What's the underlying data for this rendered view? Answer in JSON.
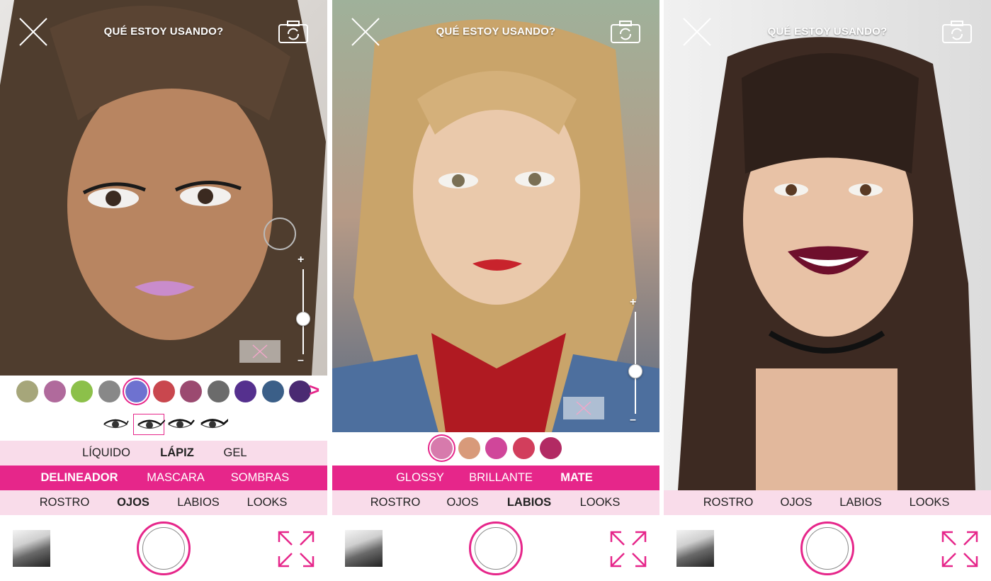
{
  "screens": [
    {
      "title": "QUÉ ESTOY USANDO?",
      "swatches": [
        {
          "color": "#a6a67a",
          "selected": false
        },
        {
          "color": "#b06a9c",
          "selected": false
        },
        {
          "color": "#8cc04a",
          "selected": false
        },
        {
          "color": "#888888",
          "selected": false
        },
        {
          "color": "#6e72d0",
          "selected": true
        },
        {
          "color": "#c9474e",
          "selected": false
        },
        {
          "color": "#9b4a70",
          "selected": false
        },
        {
          "color": "#6b6b6b",
          "selected": false
        },
        {
          "color": "#55308e",
          "selected": false
        },
        {
          "color": "#3b5f88",
          "selected": false
        },
        {
          "color": "#4a2a72",
          "selected": false
        }
      ],
      "next_arrow": ">",
      "eye_styles": [
        {
          "icon": "eyeliner-style-1-icon",
          "selected": false
        },
        {
          "icon": "eyeliner-style-2-icon",
          "selected": true
        },
        {
          "icon": "eyeliner-style-3-icon",
          "selected": false
        },
        {
          "icon": "eyeliner-style-4-icon",
          "selected": false
        }
      ],
      "finish_row": [
        "LÍQUIDO",
        "LÁPIZ",
        "GEL"
      ],
      "finish_selected": "LÁPIZ",
      "product_row": [
        "DELINEADOR",
        "MASCARA",
        "SOMBRAS"
      ],
      "product_selected": "DELINEADOR",
      "category_row": [
        "ROSTRO",
        "OJOS",
        "LABIOS",
        "LOOKS"
      ],
      "category_selected": "OJOS",
      "slider_plus": "+",
      "slider_minus": "–"
    },
    {
      "title": "QUÉ ESTOY USANDO?",
      "swatches": [
        {
          "color": "#d77aac",
          "selected": true
        },
        {
          "color": "#d89a7a",
          "selected": false
        },
        {
          "color": "#d0469a",
          "selected": false
        },
        {
          "color": "#d23e5c",
          "selected": false
        },
        {
          "color": "#b22a63",
          "selected": false
        }
      ],
      "product_row": [
        "GLOSSY",
        "BRILLANTE",
        "MATE"
      ],
      "product_selected": "MATE",
      "category_row": [
        "ROSTRO",
        "OJOS",
        "LABIOS",
        "LOOKS"
      ],
      "category_selected": "LABIOS",
      "slider_plus": "+",
      "slider_minus": "–"
    },
    {
      "title": "QUÉ ESTOY USANDO?",
      "category_row": [
        "ROSTRO",
        "OJOS",
        "LABIOS",
        "LOOKS"
      ],
      "category_selected": ""
    }
  ],
  "colors": {
    "accent": "#e6268a",
    "light_row": "#f9dcea"
  },
  "icons": {
    "close": "close-icon",
    "camera_switch": "camera-switch-icon",
    "gallery": "gallery-thumbnail-icon",
    "capture": "capture-shutter-icon",
    "expand": "expand-fullscreen-icon",
    "reset": "reset-x-icon"
  }
}
